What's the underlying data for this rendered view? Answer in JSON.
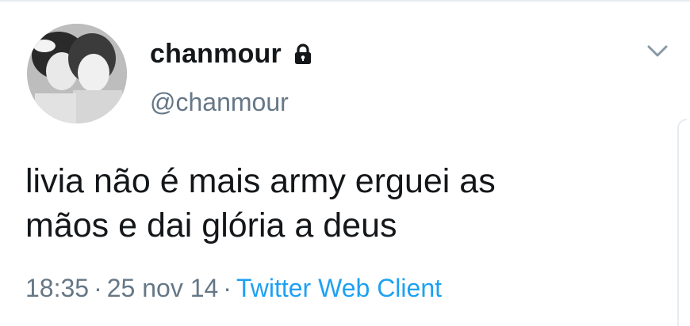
{
  "tweet": {
    "display_name": "chanmour",
    "handle": "@chanmour",
    "text_line_1": "livia não é mais army erguei as",
    "text_line_2": "mãos e dai glória a deus",
    "time": "18:35",
    "separator": "·",
    "date": "25 nov 14",
    "source": "Twitter Web Client"
  },
  "icons": {
    "lock": "lock-icon",
    "menu": "chevron-down-icon",
    "avatar": "avatar"
  },
  "colors": {
    "text": "#14171a",
    "secondary": "#657786",
    "link": "#1da1f2",
    "border": "#e6ecf0"
  }
}
